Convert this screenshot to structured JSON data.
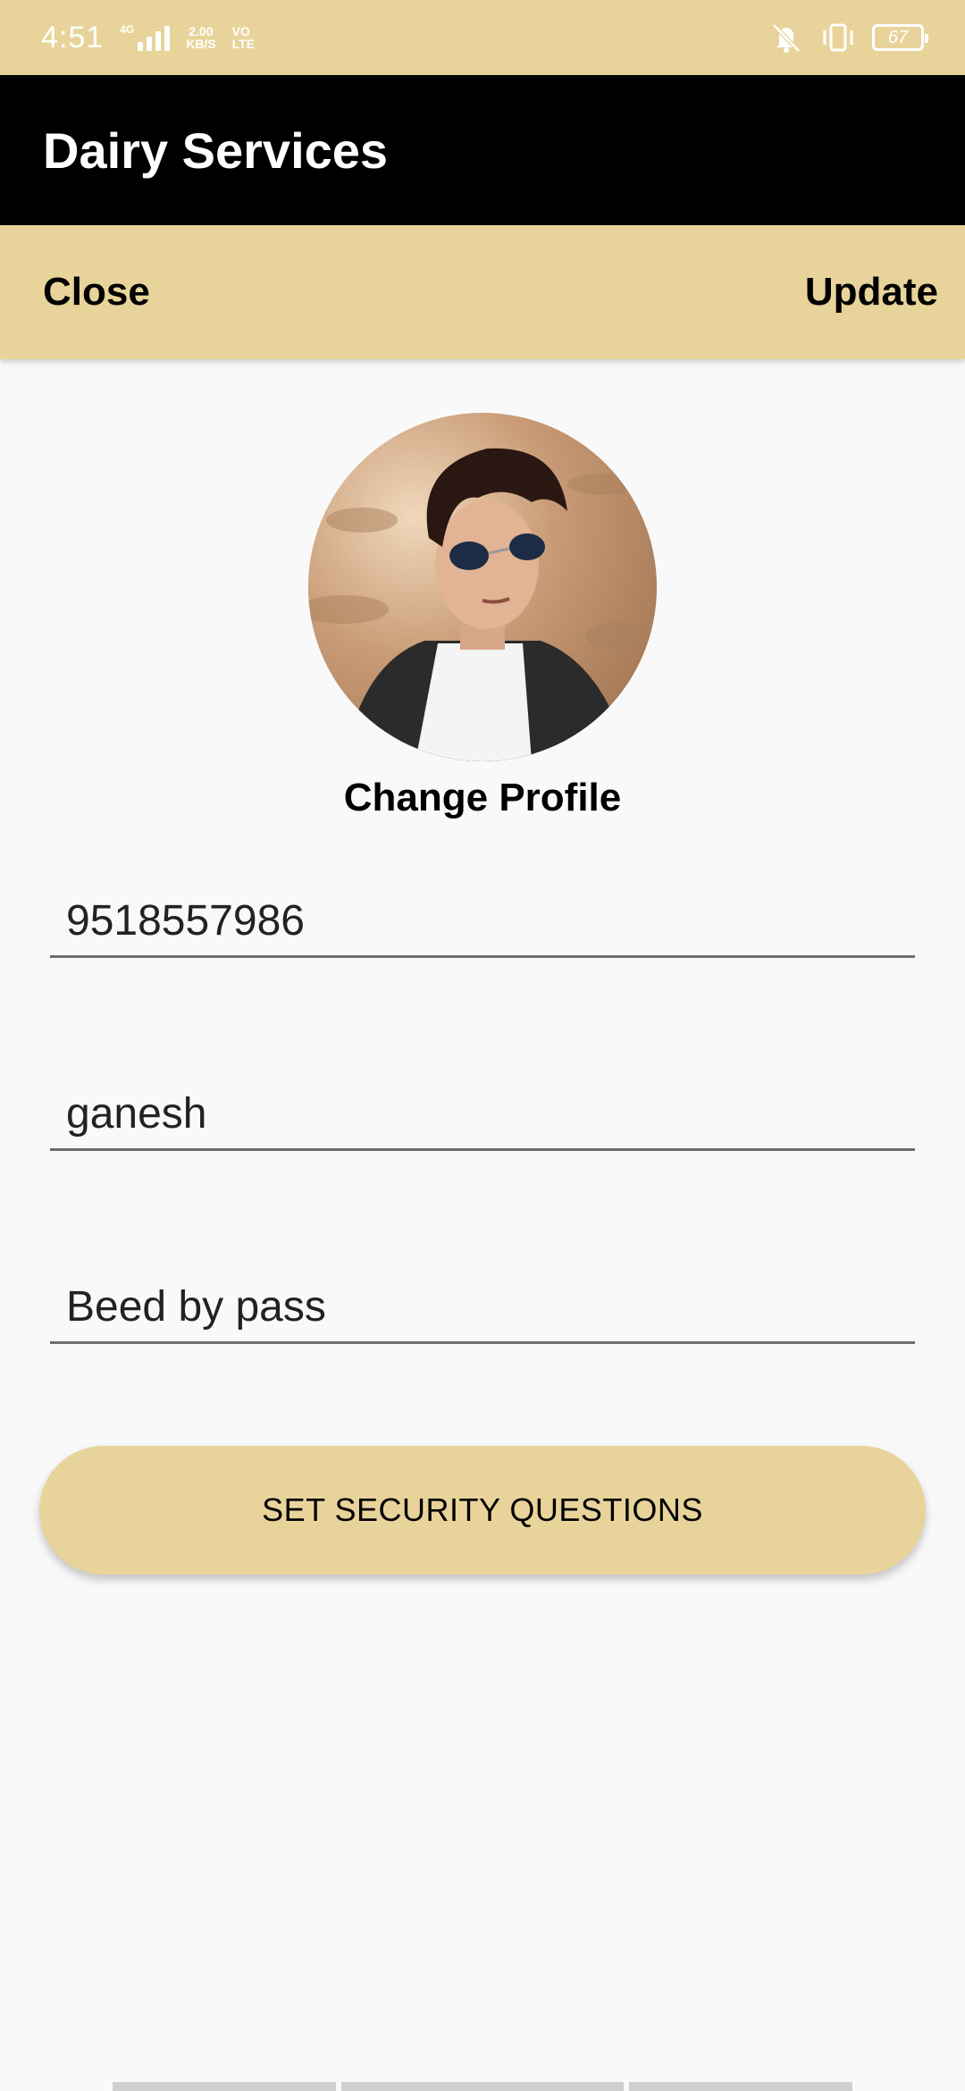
{
  "status_bar": {
    "time": "4:51",
    "network_type": "4G",
    "speed_value": "2.00",
    "speed_unit": "KB/S",
    "vo": "VO",
    "lte": "LTE",
    "battery": "67",
    "icons": [
      "signal-icon",
      "mute-icon",
      "vibrate-icon",
      "battery-icon"
    ],
    "color": "#e8d49a"
  },
  "app_bar": {
    "title": "Dairy Services",
    "color": "#000000"
  },
  "action_bar": {
    "close_label": "Close",
    "update_label": "Update",
    "color": "#e8d49a"
  },
  "profile": {
    "change_label": "Change Profile"
  },
  "form": {
    "phone_value": "9518557986",
    "name_value": "ganesh",
    "address_value": "Beed by pass"
  },
  "security_button": {
    "label": "SET SECURITY QUESTIONS",
    "color": "#e8d49a"
  }
}
